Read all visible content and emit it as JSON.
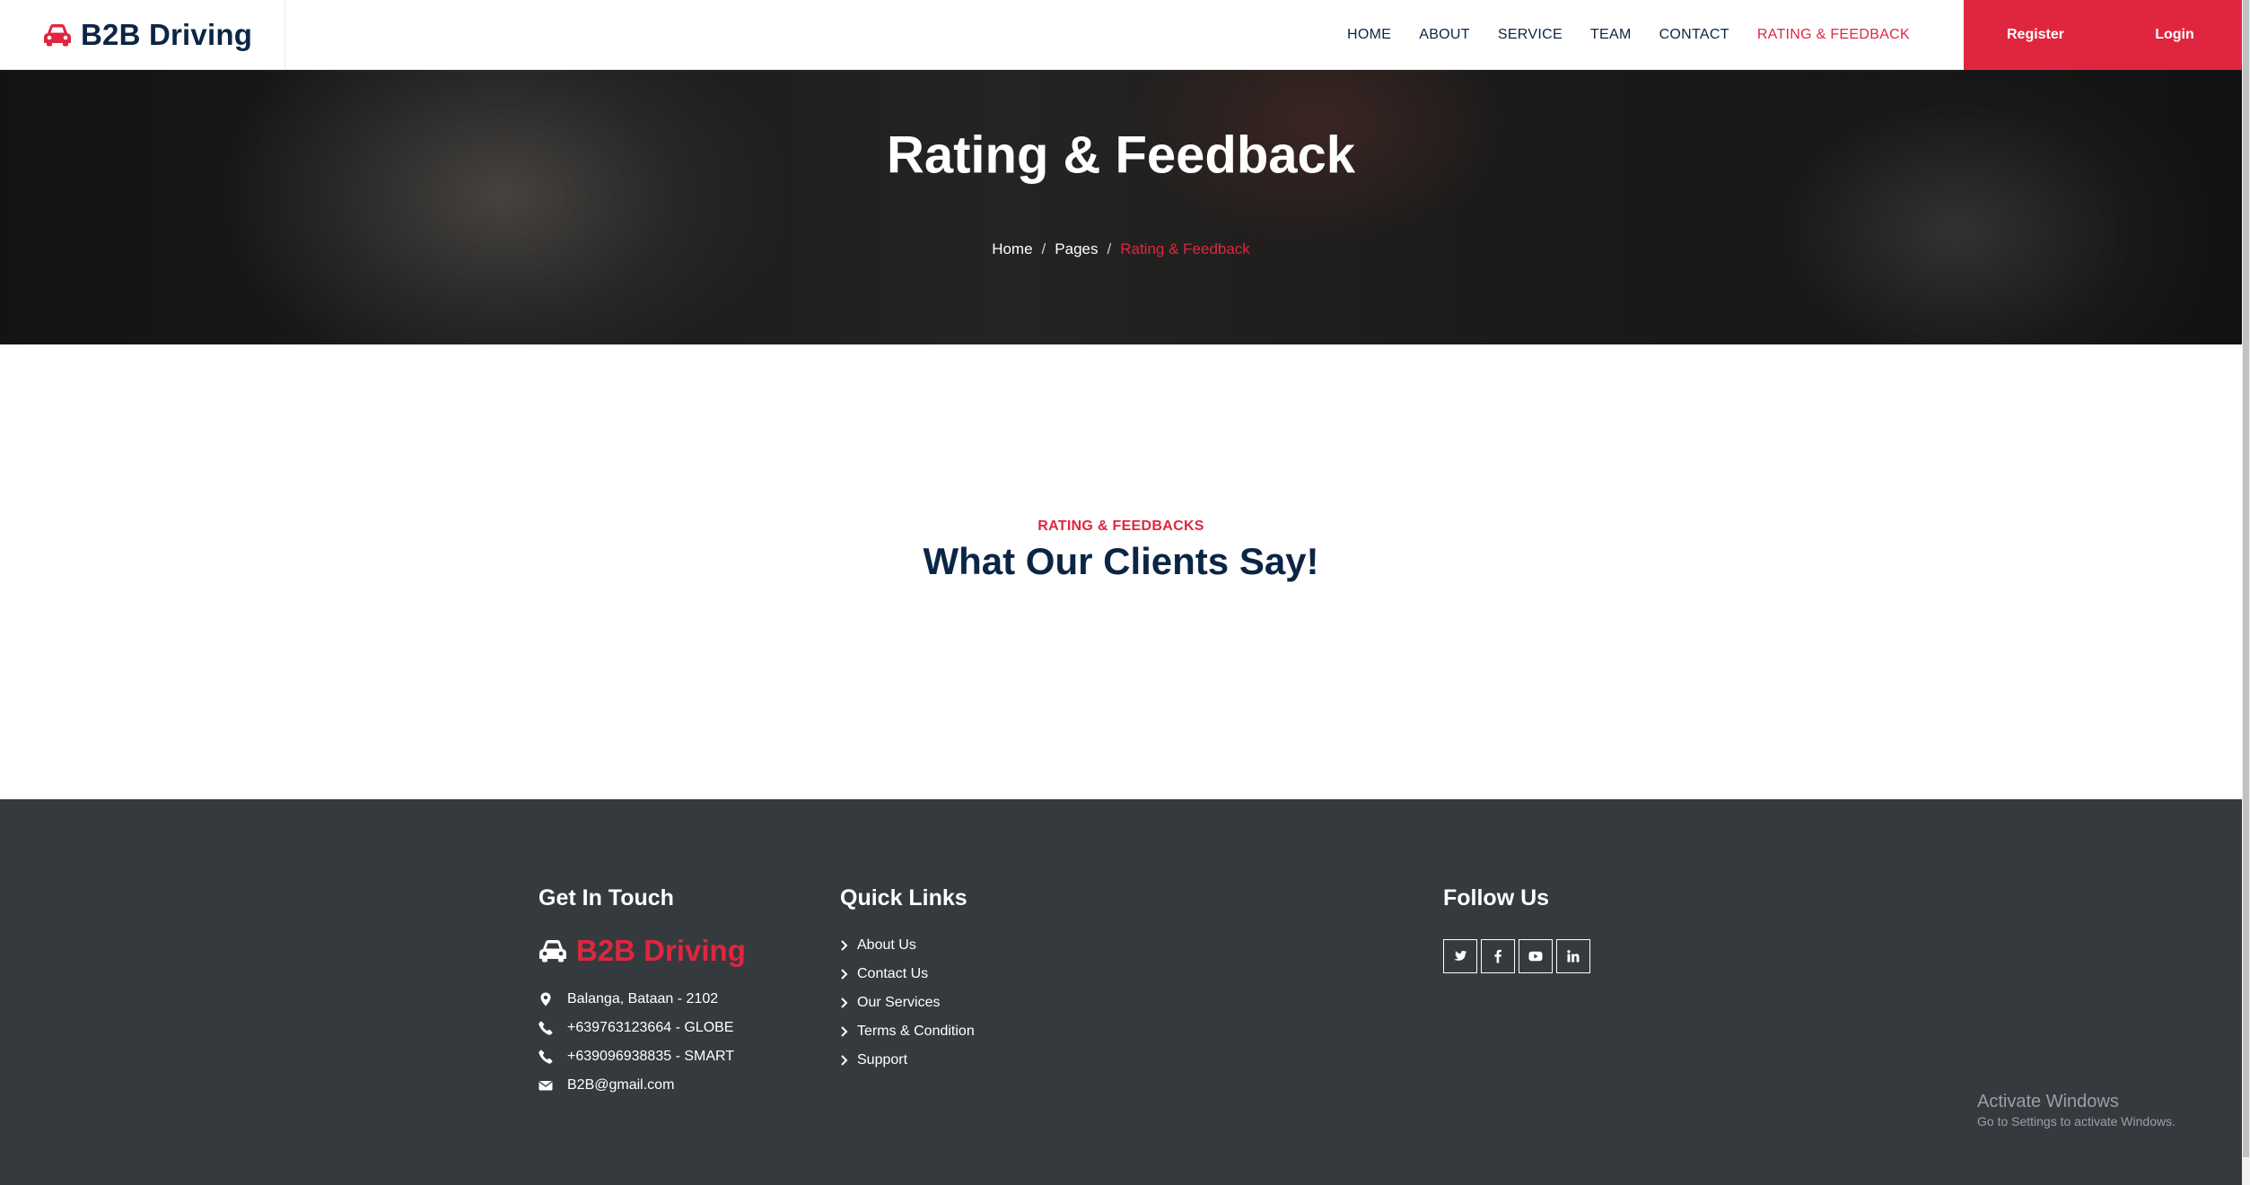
{
  "brand": {
    "name": "B2B Driving",
    "icon": "car-icon"
  },
  "nav": {
    "items": [
      {
        "label": "HOME",
        "active": false
      },
      {
        "label": "ABOUT",
        "active": false
      },
      {
        "label": "SERVICE",
        "active": false
      },
      {
        "label": "TEAM",
        "active": false
      },
      {
        "label": "CONTACT",
        "active": false
      },
      {
        "label": "RATING & FEEDBACK",
        "active": true
      }
    ],
    "register_label": "Register",
    "login_label": "Login"
  },
  "hero": {
    "title": "Rating & Feedback",
    "breadcrumb": {
      "home": "Home",
      "pages": "Pages",
      "current": "Rating & Feedback",
      "separator": "/"
    }
  },
  "section": {
    "subtitle": "RATING & FEEDBACKS",
    "title": "What Our Clients Say!"
  },
  "footer": {
    "get_in_touch": {
      "title": "Get In Touch",
      "brand": "B2B Driving",
      "address": "Balanga, Bataan - 2102",
      "phone_globe": "+639763123664 - GLOBE",
      "phone_smart": "+639096938835 - SMART",
      "email": "B2B@gmail.com"
    },
    "quick_links": {
      "title": "Quick Links",
      "items": [
        "About Us",
        "Contact Us",
        "Our Services",
        "Terms & Condition",
        "Support"
      ]
    },
    "follow_us": {
      "title": "Follow Us",
      "icons": [
        "twitter-icon",
        "facebook-icon",
        "youtube-icon",
        "linkedin-icon"
      ]
    }
  },
  "os_overlay": {
    "line1": "Activate Windows",
    "line2": "Go to Settings to activate Windows."
  },
  "colors": {
    "accent": "#e0263f",
    "navy": "#0b2545",
    "footer_bg": "#353a3f"
  }
}
